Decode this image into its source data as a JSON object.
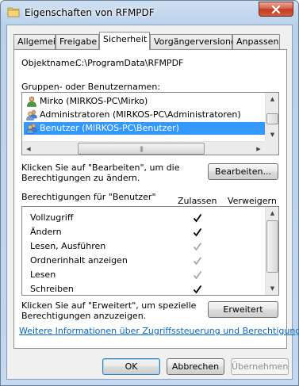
{
  "window": {
    "title": "Eigenschaften von RFMPDF"
  },
  "tabs": [
    {
      "label": "Allgemein"
    },
    {
      "label": "Freigabe"
    },
    {
      "label": "Sicherheit"
    },
    {
      "label": "Vorgängerversionen"
    },
    {
      "label": "Anpassen"
    }
  ],
  "active_tab": "Sicherheit",
  "object": {
    "label": "Objektname:",
    "value": "C:\\ProgramData\\RFMPDF"
  },
  "groups": {
    "label": "Gruppen- oder Benutzernamen:",
    "items": [
      {
        "name": "Mirko (MIRKOS-PC\\Mirko)",
        "icon": "user-icon",
        "selected": false
      },
      {
        "name": "Administratoren (MIRKOS-PC\\Administratoren)",
        "icon": "group-icon",
        "selected": false
      },
      {
        "name": "Benutzer (MIRKOS-PC\\Benutzer)",
        "icon": "group-icon",
        "selected": true
      }
    ]
  },
  "edit": {
    "hint_line1": "Klicken Sie auf \"Bearbeiten\", um die",
    "hint_line2": "Berechtigungen zu ändern.",
    "button_label": "Bearbeiten..."
  },
  "permissions": {
    "label": "Berechtigungen für \"Benutzer\"",
    "col_allow": "Zulassen",
    "col_deny": "Verweigern",
    "rows": [
      {
        "name": "Vollzugriff",
        "allow": "checked"
      },
      {
        "name": "Ändern",
        "allow": "checked"
      },
      {
        "name": "Lesen, Ausführen",
        "allow": "inherited"
      },
      {
        "name": "Ordnerinhalt anzeigen",
        "allow": "inherited"
      },
      {
        "name": "Lesen",
        "allow": "inherited"
      },
      {
        "name": "Schreiben",
        "allow": "checked"
      }
    ]
  },
  "advanced": {
    "hint_line1": "Klicken Sie auf \"Erweitert\", um spezielle",
    "hint_line2": "Berechtigungen anzuzeigen.",
    "button_label": "Erweitert"
  },
  "info_link": "Weitere Informationen über Zugriffssteuerung und Berechtigungen",
  "footer": {
    "ok": "OK",
    "cancel": "Abbrechen",
    "apply": "Übernehmen"
  },
  "colors": {
    "selection": "#3399ff",
    "link": "#0066cc"
  }
}
